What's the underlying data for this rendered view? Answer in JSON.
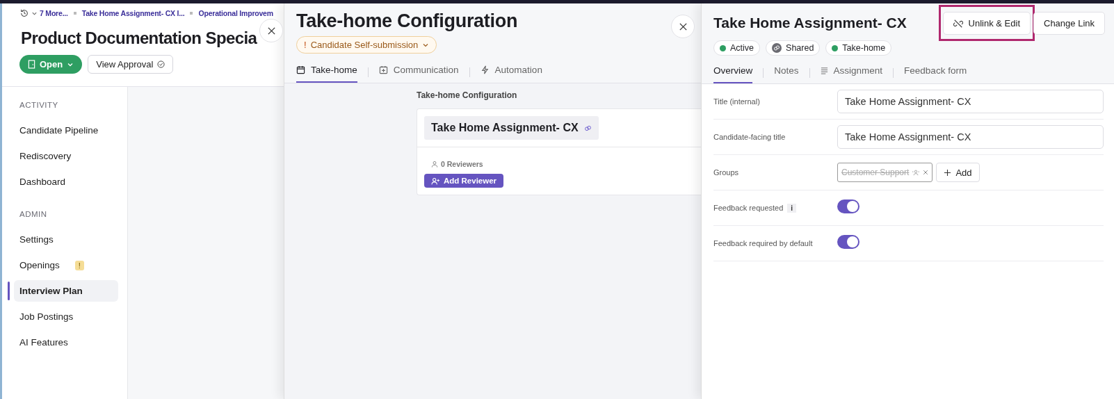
{
  "breadcrumbs": [
    {
      "label": "7 More..."
    },
    {
      "label": "Take Home Assignment- CX I..."
    },
    {
      "label": "Operational Improvem"
    }
  ],
  "page": {
    "title": "Product Documentation Specia",
    "status": "Open",
    "approval": "View Approval"
  },
  "sidebar": {
    "sections": [
      {
        "heading": "ACTIVITY",
        "items": [
          {
            "label": "Candidate Pipeline",
            "selected": false,
            "warning": false
          },
          {
            "label": "Rediscovery",
            "selected": false,
            "warning": false
          },
          {
            "label": "Dashboard",
            "selected": false,
            "warning": false
          }
        ]
      },
      {
        "heading": "ADMIN",
        "items": [
          {
            "label": "Settings",
            "selected": false,
            "warning": false
          },
          {
            "label": "Openings",
            "selected": false,
            "warning": true,
            "badge": "!"
          },
          {
            "label": "Interview Plan",
            "selected": true,
            "warning": false
          },
          {
            "label": "Job Postings",
            "selected": false,
            "warning": false
          },
          {
            "label": "AI Features",
            "selected": false,
            "warning": false
          }
        ]
      }
    ]
  },
  "config_panel": {
    "title": "Take-home Configuration",
    "mode": {
      "mark": "!",
      "label": "Candidate Self-submission"
    },
    "tabs": [
      {
        "label": "Take-home",
        "selected": true
      },
      {
        "label": "Communication",
        "selected": false
      },
      {
        "label": "Automation",
        "selected": false
      }
    ],
    "section_title": "Take-home Configuration",
    "card": {
      "title": "Take Home Assignment- CX",
      "reviewers": "0 Reviewers",
      "add_button": "Add Reviewer"
    }
  },
  "detail_panel": {
    "title": "Take Home Assignment- CX",
    "buttons": [
      {
        "label": "Unlink & Edit",
        "highlighted": true
      },
      {
        "label": "Change Link",
        "highlighted": false
      }
    ],
    "badges": [
      {
        "label": "Active",
        "kind": "dot",
        "color": "#2e9e62"
      },
      {
        "label": "Shared",
        "kind": "link",
        "color": "#6b6b72"
      },
      {
        "label": "Take-home",
        "kind": "dot",
        "color": "#2e9e62"
      }
    ],
    "tabs": [
      {
        "label": "Overview",
        "selected": true
      },
      {
        "label": "Notes",
        "selected": false
      },
      {
        "label": "Assignment",
        "selected": false
      },
      {
        "label": "Feedback form",
        "selected": false
      }
    ],
    "fields": [
      {
        "kind": "text",
        "label": "Title (internal)",
        "value": "Take Home Assignment- CX"
      },
      {
        "kind": "text",
        "label": "Candidate-facing title",
        "value": "Take Home Assignment- CX"
      },
      {
        "kind": "groups",
        "label": "Groups",
        "chips": [
          {
            "label": "Customer Support",
            "removed": true
          }
        ],
        "add": "Add"
      },
      {
        "kind": "toggle",
        "label": "Feedback requested",
        "info": "i",
        "on": true
      },
      {
        "kind": "toggle",
        "label": "Feedback required by default",
        "on": true
      }
    ]
  }
}
